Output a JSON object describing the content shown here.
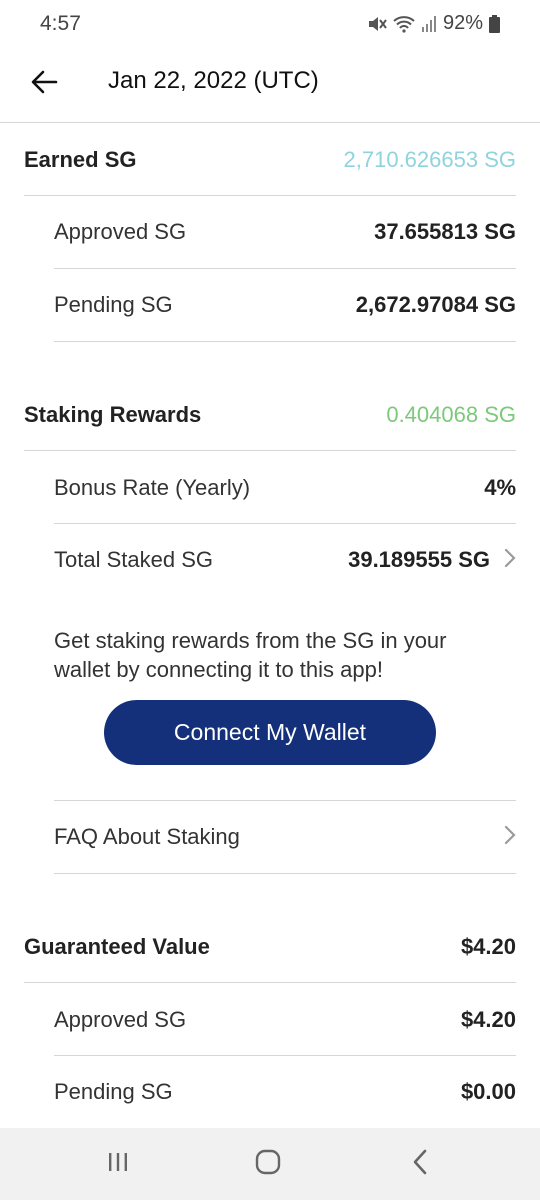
{
  "status_bar": {
    "time": "4:57",
    "battery": "92%"
  },
  "header": {
    "title": "Jan 22, 2022 (UTC)"
  },
  "earned": {
    "label": "Earned SG",
    "value": "2,710.626653 SG",
    "approved_label": "Approved SG",
    "approved_value": "37.655813 SG",
    "pending_label": "Pending SG",
    "pending_value": "2,672.97084 SG"
  },
  "staking": {
    "label": "Staking Rewards",
    "value": "0.404068 SG",
    "bonus_label": "Bonus Rate (Yearly)",
    "bonus_value": "4%",
    "staked_label": "Total Staked SG",
    "staked_value": "39.189555 SG",
    "info": "Get staking rewards from the SG in your wallet by connecting it to this app!",
    "connect_label": "Connect My Wallet",
    "faq_label": "FAQ About Staking"
  },
  "guaranteed": {
    "label": "Guaranteed Value",
    "value": "$4.20",
    "approved_label": "Approved SG",
    "approved_value": "$4.20",
    "pending_label": "Pending SG",
    "pending_value": "$0.00"
  },
  "colors": {
    "earned_value": "#8fd3de",
    "staking_value": "#7cc97a",
    "button": "#14307a"
  },
  "nav": {
    "icons": [
      "recent-apps-icon",
      "home-icon",
      "back-nav-icon"
    ]
  }
}
